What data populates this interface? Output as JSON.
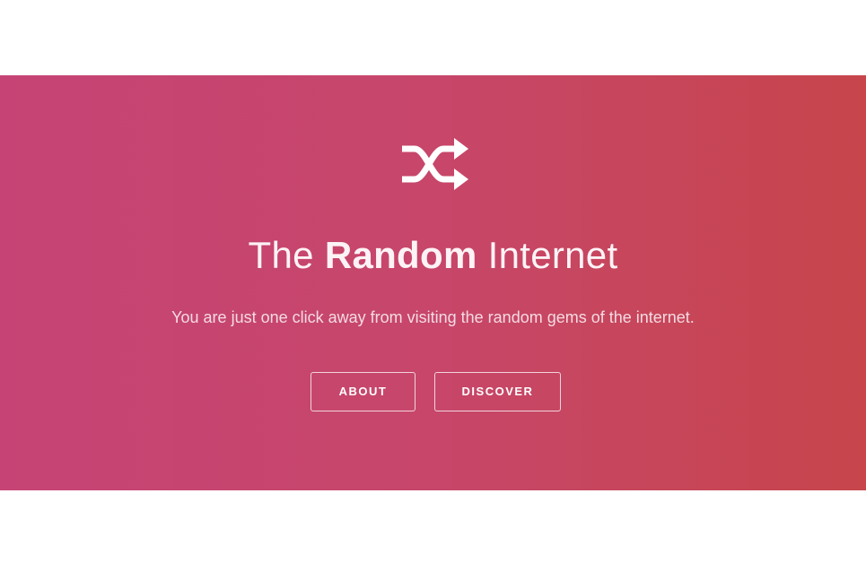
{
  "hero": {
    "icon": "shuffle-icon",
    "title_prefix": "The",
    "title_emphasis": "Random",
    "title_suffix": "Internet",
    "subtitle": "You are just one click away from visiting the random gems of the internet.",
    "buttons": {
      "about_label": "ABOUT",
      "discover_label": "DISCOVER"
    },
    "colors": {
      "gradient_start": "#c64475",
      "gradient_end": "#c7454b",
      "text": "#ffffff"
    }
  }
}
